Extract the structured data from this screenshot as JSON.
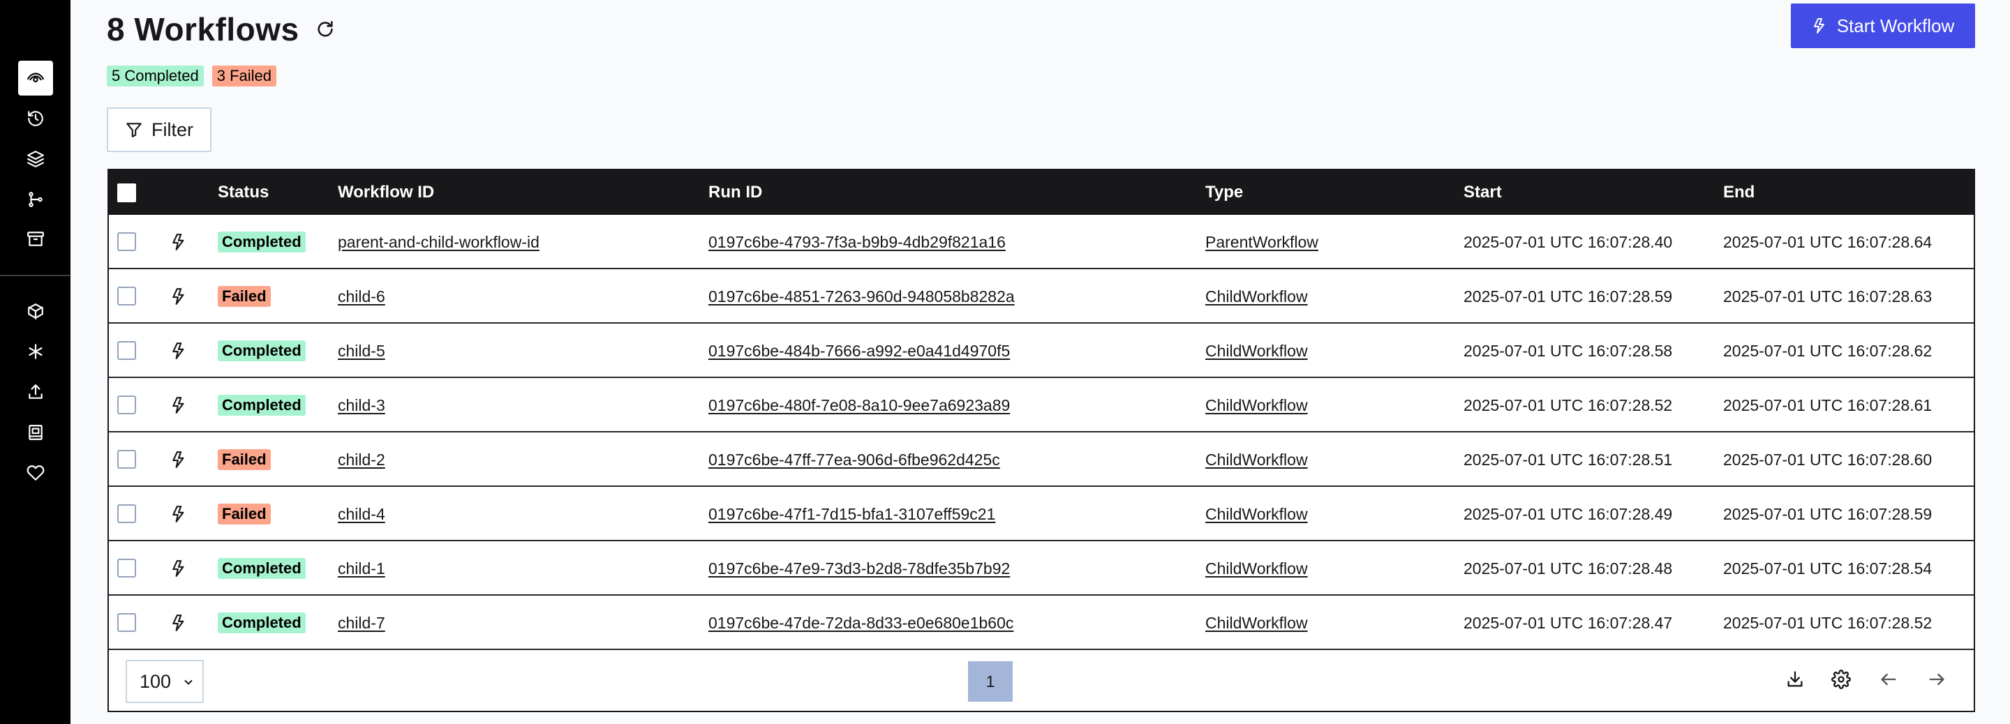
{
  "header": {
    "title": "8 Workflows",
    "start_button": "Start Workflow",
    "filter_button": "Filter",
    "summary": [
      {
        "label": "5 Completed",
        "kind": "completed"
      },
      {
        "label": "3 Failed",
        "kind": "failed"
      }
    ]
  },
  "sidebar": {
    "items": [
      {
        "icon": "eye-icon",
        "active": true
      },
      {
        "icon": "history-icon"
      },
      {
        "icon": "layers-icon"
      },
      {
        "icon": "git-branch-icon"
      },
      {
        "icon": "archive-icon"
      },
      {
        "icon": "box-icon"
      },
      {
        "icon": "asterisk-icon"
      },
      {
        "icon": "upload-icon"
      },
      {
        "icon": "book-icon"
      },
      {
        "icon": "heart-icon"
      }
    ]
  },
  "table": {
    "columns": [
      "Status",
      "Workflow ID",
      "Run ID",
      "Type",
      "Start",
      "End"
    ],
    "rows": [
      {
        "status": "Completed",
        "workflow_id": "parent-and-child-workflow-id",
        "run_id": "0197c6be-4793-7f3a-b9b9-4db29f821a16",
        "type": "ParentWorkflow",
        "start": "2025-07-01 UTC 16:07:28.40",
        "end": "2025-07-01 UTC 16:07:28.64"
      },
      {
        "status": "Failed",
        "workflow_id": "child-6",
        "run_id": "0197c6be-4851-7263-960d-948058b8282a",
        "type": "ChildWorkflow",
        "start": "2025-07-01 UTC 16:07:28.59",
        "end": "2025-07-01 UTC 16:07:28.63"
      },
      {
        "status": "Completed",
        "workflow_id": "child-5",
        "run_id": "0197c6be-484b-7666-a992-e0a41d4970f5",
        "type": "ChildWorkflow",
        "start": "2025-07-01 UTC 16:07:28.58",
        "end": "2025-07-01 UTC 16:07:28.62"
      },
      {
        "status": "Completed",
        "workflow_id": "child-3",
        "run_id": "0197c6be-480f-7e08-8a10-9ee7a6923a89",
        "type": "ChildWorkflow",
        "start": "2025-07-01 UTC 16:07:28.52",
        "end": "2025-07-01 UTC 16:07:28.61"
      },
      {
        "status": "Failed",
        "workflow_id": "child-2",
        "run_id": "0197c6be-47ff-77ea-906d-6fbe962d425c",
        "type": "ChildWorkflow",
        "start": "2025-07-01 UTC 16:07:28.51",
        "end": "2025-07-01 UTC 16:07:28.60"
      },
      {
        "status": "Failed",
        "workflow_id": "child-4",
        "run_id": "0197c6be-47f1-7d15-bfa1-3107eff59c21",
        "type": "ChildWorkflow",
        "start": "2025-07-01 UTC 16:07:28.49",
        "end": "2025-07-01 UTC 16:07:28.59"
      },
      {
        "status": "Completed",
        "workflow_id": "child-1",
        "run_id": "0197c6be-47e9-73d3-b2d8-78dfe35b7b92",
        "type": "ChildWorkflow",
        "start": "2025-07-01 UTC 16:07:28.48",
        "end": "2025-07-01 UTC 16:07:28.54"
      },
      {
        "status": "Completed",
        "workflow_id": "child-7",
        "run_id": "0197c6be-47de-72da-8d33-e0e680e1b60c",
        "type": "ChildWorkflow",
        "start": "2025-07-01 UTC 16:07:28.47",
        "end": "2025-07-01 UTC 16:07:28.52"
      }
    ]
  },
  "pagination": {
    "per_page": "100",
    "current_page": "1"
  },
  "colors": {
    "accent": "#444ce7",
    "completed": "#a7f3d0",
    "failed": "#fca58a",
    "page_active": "#a3b6d8"
  }
}
